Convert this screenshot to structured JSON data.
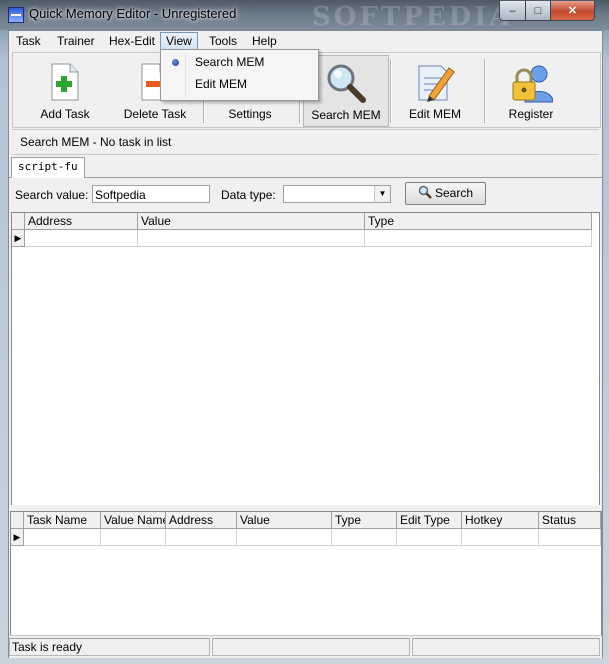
{
  "window": {
    "title": "Quick Memory Editor - Unregistered",
    "watermark": "SOFTPEDIA",
    "min_glyph": "–",
    "max_glyph": "□",
    "close_glyph": "✕"
  },
  "menubar": {
    "items": [
      "Task",
      "Trainer",
      "Hex-Edit",
      "View",
      "Tools",
      "Help"
    ],
    "open_menu": "View"
  },
  "view_menu": {
    "items": [
      {
        "label": "Search MEM",
        "checked": true
      },
      {
        "label": "Edit MEM",
        "checked": false
      }
    ]
  },
  "toolbar": {
    "buttons": [
      {
        "label": "Add Task",
        "icon": "add-task-icon"
      },
      {
        "label": "Delete Task",
        "icon": "delete-task-icon"
      },
      {
        "label": "Settings",
        "icon": "settings-icon"
      },
      {
        "label": "Search MEM",
        "icon": "magnifier-icon",
        "pressed": true
      },
      {
        "label": "Edit MEM",
        "icon": "edit-document-icon"
      },
      {
        "label": "Register",
        "icon": "lock-user-icon"
      }
    ]
  },
  "status_message": "Search MEM - No task in list",
  "tabs": [
    "script-fu"
  ],
  "search": {
    "value_label": "Search value:",
    "value": "Softpedia",
    "type_label": "Data type:",
    "type_value": "",
    "button_label": "Search"
  },
  "results_grid": {
    "columns": [
      "Address",
      "Value",
      "Type"
    ]
  },
  "task_grid": {
    "columns": [
      "Task Name",
      "Value Name",
      "Address",
      "Value",
      "Type",
      "Edit Type",
      "Hotkey",
      "Status"
    ]
  },
  "statusbar": {
    "text": "Task is ready"
  },
  "colors": {
    "menu_highlight": "#d2e1f2",
    "close_button": "#c24a2d"
  }
}
